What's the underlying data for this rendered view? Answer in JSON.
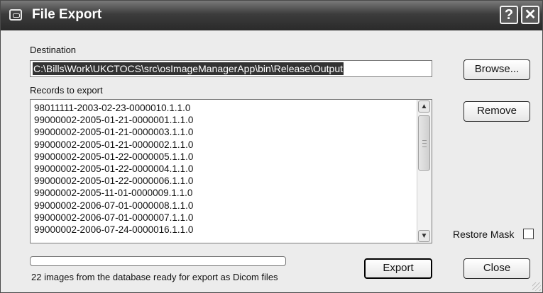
{
  "window": {
    "title": "File Export",
    "help_label": "?",
    "close_label": "✕"
  },
  "destination": {
    "label": "Destination",
    "value": "C:\\Bills\\Work\\UKCTOCS\\src\\osImageManagerApp\\bin\\Release\\Output",
    "browse_label": "Browse..."
  },
  "records": {
    "label": "Records to export",
    "items": [
      "98011111-2003-02-23-0000010.1.1.0",
      "99000002-2005-01-21-0000001.1.1.0",
      "99000002-2005-01-21-0000003.1.1.0",
      "99000002-2005-01-21-0000002.1.1.0",
      "99000002-2005-01-22-0000005.1.1.0",
      "99000002-2005-01-22-0000004.1.1.0",
      "99000002-2005-01-22-0000006.1.1.0",
      "99000002-2005-11-01-0000009.1.1.0",
      "99000002-2006-07-01-0000008.1.1.0",
      "99000002-2006-07-01-0000007.1.1.0",
      "99000002-2006-07-24-0000016.1.1.0"
    ],
    "remove_label": "Remove"
  },
  "options": {
    "restore_mask_label": "Restore Mask",
    "restore_mask_checked": false
  },
  "progress": {
    "value": 0
  },
  "status": {
    "text": "22 images from the database ready for export as Dicom files"
  },
  "actions": {
    "export_label": "Export",
    "close_label": "Close"
  }
}
